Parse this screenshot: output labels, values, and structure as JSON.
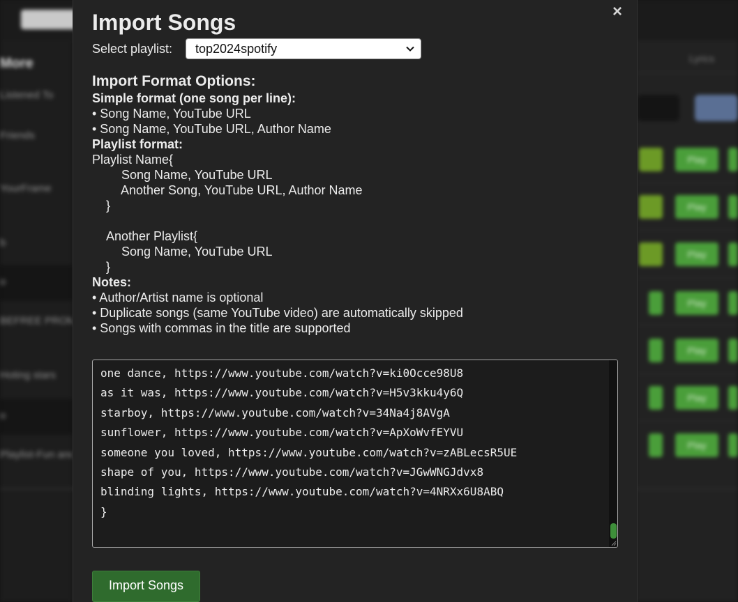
{
  "modal": {
    "title": "Import Songs",
    "close_symbol": "×",
    "select_label": "Select playlist:",
    "select_value": "top2024spotify",
    "format_heading": "Import Format Options:",
    "simple_heading": "Simple format (one song per line):",
    "simple_items": [
      "Song Name, YouTube URL",
      "Song Name, YouTube URL, Author Name"
    ],
    "playlist_heading": "Playlist format:",
    "playlist_example": {
      "line1": "Playlist Name{",
      "line2": "Song Name, YouTube URL",
      "line3": "Another Song, YouTube URL, Author Name",
      "line4": "}",
      "line5": "Another Playlist{",
      "line6": "Song Name, YouTube URL",
      "line7": "}"
    },
    "notes_heading": "Notes:",
    "notes_items": [
      "Author/Artist name is optional",
      "Duplicate songs (same YouTube video) are automatically skipped",
      "Songs with commas in the title are supported"
    ],
    "editor_lines": [
      "one dance, https://www.youtube.com/watch?v=ki0Occe98U8",
      "as it was, https://www.youtube.com/watch?v=H5v3kku4y6Q",
      "starboy, https://www.youtube.com/watch?v=34Na4j8AVgA",
      "sunflower, https://www.youtube.com/watch?v=ApXoWvfEYVU",
      "someone you loved, https://www.youtube.com/watch?v=zABLecsR5UE",
      "shape of you, https://www.youtube.com/watch?v=JGwWNGJdvx8",
      "blinding lights, https://www.youtube.com/watch?v=4NRXx6U8ABQ",
      "}"
    ],
    "import_button": "Import Songs"
  },
  "background": {
    "sidebar_title": "More",
    "sidebar_items": [
      "Listened To",
      "Friends",
      "YourFrame",
      "b",
      "o",
      "BEFREE PROMO",
      "Hoting stars",
      "o",
      "Playlist-Fun and"
    ],
    "right_tab": "Lyrics",
    "row_button_label": "Play",
    "colors": {
      "accent_green": "#4a9e3a",
      "button_green": "#2f6b2d",
      "modal_bg": "#232323"
    }
  }
}
